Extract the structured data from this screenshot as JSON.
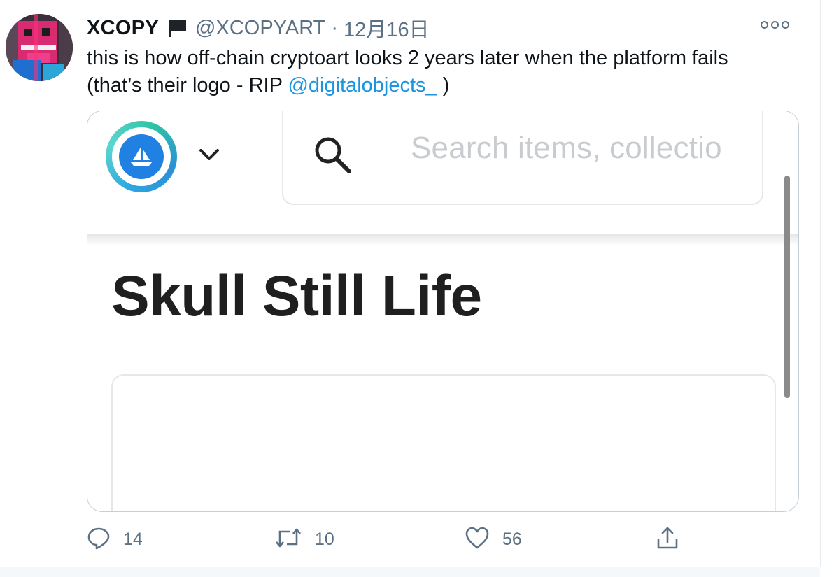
{
  "tweet": {
    "name": "XCOPY",
    "handle": "@XCOPYART",
    "separator": "·",
    "date": "12月16日",
    "text_line1": "this is how off-chain cryptoart looks 2 years later when the platform fails",
    "text_line2_before": "(that’s their logo - RIP ",
    "mention": "@digitalobjects_",
    "text_line2_after": " )",
    "icons": {
      "flag": "flag-icon",
      "more": "more-options-icon"
    }
  },
  "media": {
    "search_placeholder": "Search items, collectio",
    "title": "Skull Still Life",
    "icons": {
      "logo": "ship-logo-icon",
      "dropdown": "chevron-down-icon",
      "search": "search-icon"
    }
  },
  "actions": {
    "reply_count": "14",
    "retweet_count": "10",
    "like_count": "56",
    "icons": {
      "reply": "reply-icon",
      "retweet": "retweet-icon",
      "like": "heart-icon",
      "share": "share-icon"
    }
  },
  "colors": {
    "link": "#1b95e0",
    "secondary_text": "#5b7083",
    "logo_blue": "#2081e2"
  }
}
